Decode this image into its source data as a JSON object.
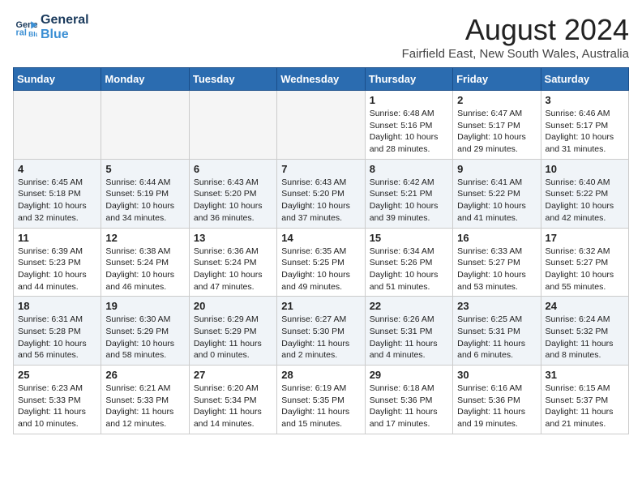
{
  "header": {
    "logo_line1": "General",
    "logo_line2": "Blue",
    "month_year": "August 2024",
    "location": "Fairfield East, New South Wales, Australia"
  },
  "weekdays": [
    "Sunday",
    "Monday",
    "Tuesday",
    "Wednesday",
    "Thursday",
    "Friday",
    "Saturday"
  ],
  "weeks": [
    [
      {
        "day": "",
        "info": ""
      },
      {
        "day": "",
        "info": ""
      },
      {
        "day": "",
        "info": ""
      },
      {
        "day": "",
        "info": ""
      },
      {
        "day": "1",
        "info": "Sunrise: 6:48 AM\nSunset: 5:16 PM\nDaylight: 10 hours\nand 28 minutes."
      },
      {
        "day": "2",
        "info": "Sunrise: 6:47 AM\nSunset: 5:17 PM\nDaylight: 10 hours\nand 29 minutes."
      },
      {
        "day": "3",
        "info": "Sunrise: 6:46 AM\nSunset: 5:17 PM\nDaylight: 10 hours\nand 31 minutes."
      }
    ],
    [
      {
        "day": "4",
        "info": "Sunrise: 6:45 AM\nSunset: 5:18 PM\nDaylight: 10 hours\nand 32 minutes."
      },
      {
        "day": "5",
        "info": "Sunrise: 6:44 AM\nSunset: 5:19 PM\nDaylight: 10 hours\nand 34 minutes."
      },
      {
        "day": "6",
        "info": "Sunrise: 6:43 AM\nSunset: 5:20 PM\nDaylight: 10 hours\nand 36 minutes."
      },
      {
        "day": "7",
        "info": "Sunrise: 6:43 AM\nSunset: 5:20 PM\nDaylight: 10 hours\nand 37 minutes."
      },
      {
        "day": "8",
        "info": "Sunrise: 6:42 AM\nSunset: 5:21 PM\nDaylight: 10 hours\nand 39 minutes."
      },
      {
        "day": "9",
        "info": "Sunrise: 6:41 AM\nSunset: 5:22 PM\nDaylight: 10 hours\nand 41 minutes."
      },
      {
        "day": "10",
        "info": "Sunrise: 6:40 AM\nSunset: 5:22 PM\nDaylight: 10 hours\nand 42 minutes."
      }
    ],
    [
      {
        "day": "11",
        "info": "Sunrise: 6:39 AM\nSunset: 5:23 PM\nDaylight: 10 hours\nand 44 minutes."
      },
      {
        "day": "12",
        "info": "Sunrise: 6:38 AM\nSunset: 5:24 PM\nDaylight: 10 hours\nand 46 minutes."
      },
      {
        "day": "13",
        "info": "Sunrise: 6:36 AM\nSunset: 5:24 PM\nDaylight: 10 hours\nand 47 minutes."
      },
      {
        "day": "14",
        "info": "Sunrise: 6:35 AM\nSunset: 5:25 PM\nDaylight: 10 hours\nand 49 minutes."
      },
      {
        "day": "15",
        "info": "Sunrise: 6:34 AM\nSunset: 5:26 PM\nDaylight: 10 hours\nand 51 minutes."
      },
      {
        "day": "16",
        "info": "Sunrise: 6:33 AM\nSunset: 5:27 PM\nDaylight: 10 hours\nand 53 minutes."
      },
      {
        "day": "17",
        "info": "Sunrise: 6:32 AM\nSunset: 5:27 PM\nDaylight: 10 hours\nand 55 minutes."
      }
    ],
    [
      {
        "day": "18",
        "info": "Sunrise: 6:31 AM\nSunset: 5:28 PM\nDaylight: 10 hours\nand 56 minutes."
      },
      {
        "day": "19",
        "info": "Sunrise: 6:30 AM\nSunset: 5:29 PM\nDaylight: 10 hours\nand 58 minutes."
      },
      {
        "day": "20",
        "info": "Sunrise: 6:29 AM\nSunset: 5:29 PM\nDaylight: 11 hours\nand 0 minutes."
      },
      {
        "day": "21",
        "info": "Sunrise: 6:27 AM\nSunset: 5:30 PM\nDaylight: 11 hours\nand 2 minutes."
      },
      {
        "day": "22",
        "info": "Sunrise: 6:26 AM\nSunset: 5:31 PM\nDaylight: 11 hours\nand 4 minutes."
      },
      {
        "day": "23",
        "info": "Sunrise: 6:25 AM\nSunset: 5:31 PM\nDaylight: 11 hours\nand 6 minutes."
      },
      {
        "day": "24",
        "info": "Sunrise: 6:24 AM\nSunset: 5:32 PM\nDaylight: 11 hours\nand 8 minutes."
      }
    ],
    [
      {
        "day": "25",
        "info": "Sunrise: 6:23 AM\nSunset: 5:33 PM\nDaylight: 11 hours\nand 10 minutes."
      },
      {
        "day": "26",
        "info": "Sunrise: 6:21 AM\nSunset: 5:33 PM\nDaylight: 11 hours\nand 12 minutes."
      },
      {
        "day": "27",
        "info": "Sunrise: 6:20 AM\nSunset: 5:34 PM\nDaylight: 11 hours\nand 14 minutes."
      },
      {
        "day": "28",
        "info": "Sunrise: 6:19 AM\nSunset: 5:35 PM\nDaylight: 11 hours\nand 15 minutes."
      },
      {
        "day": "29",
        "info": "Sunrise: 6:18 AM\nSunset: 5:36 PM\nDaylight: 11 hours\nand 17 minutes."
      },
      {
        "day": "30",
        "info": "Sunrise: 6:16 AM\nSunset: 5:36 PM\nDaylight: 11 hours\nand 19 minutes."
      },
      {
        "day": "31",
        "info": "Sunrise: 6:15 AM\nSunset: 5:37 PM\nDaylight: 11 hours\nand 21 minutes."
      }
    ]
  ]
}
